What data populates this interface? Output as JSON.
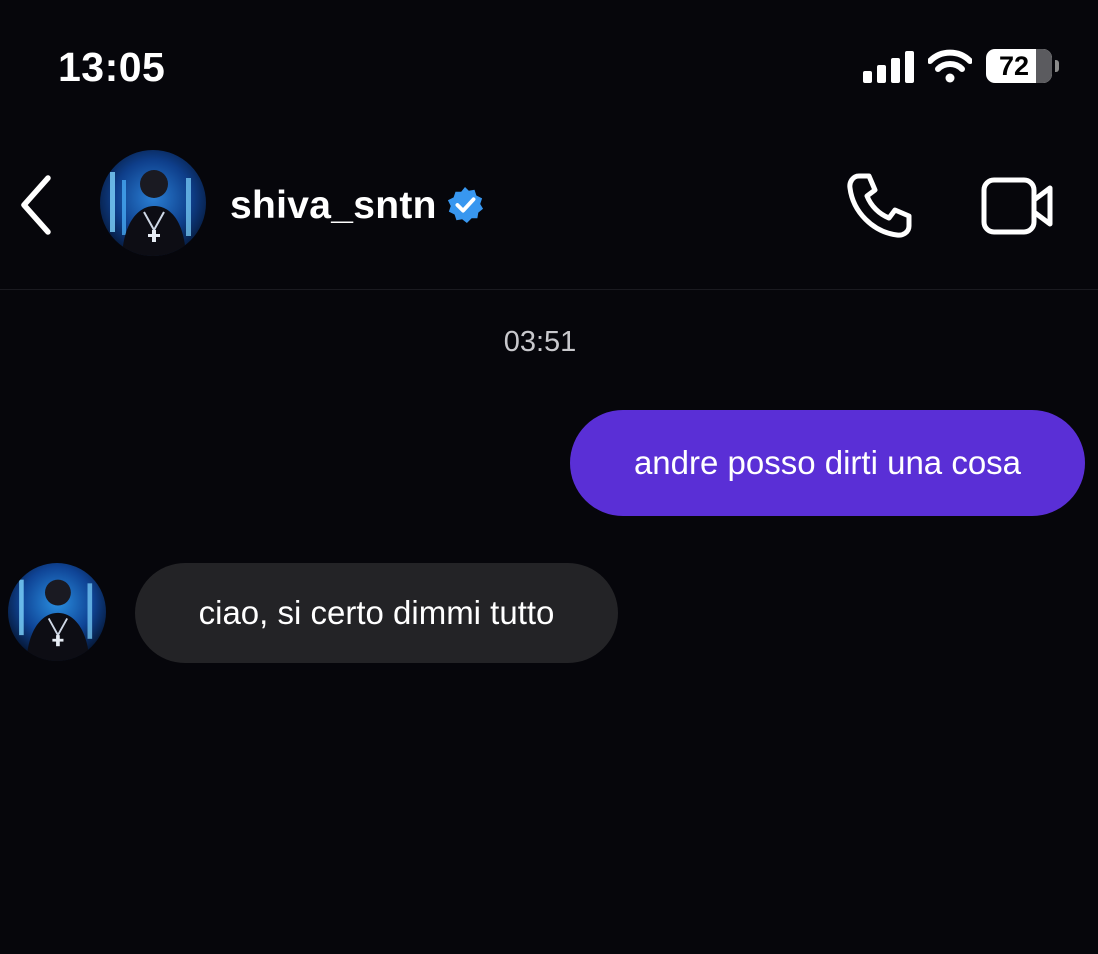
{
  "status_bar": {
    "time": "13:05",
    "battery_level": "72",
    "icons": [
      "signal-icon",
      "wifi-icon",
      "battery-icon"
    ]
  },
  "header": {
    "username": "shiva_sntn",
    "verified": true,
    "icons": [
      "back-arrow-icon",
      "avatar",
      "verified-badge-icon",
      "phone-call-icon",
      "video-call-icon"
    ]
  },
  "conversation": {
    "timestamp": "03:51",
    "messages": [
      {
        "direction": "outgoing",
        "text": "andre posso dirti una cosa"
      },
      {
        "direction": "incoming",
        "text": "ciao, si certo dimmi tutto"
      }
    ]
  },
  "colors": {
    "background": "#06060b",
    "outgoing_bubble": "#5a2fd6",
    "incoming_bubble": "#232326",
    "verified_badge": "#3897f0",
    "text": "#ffffff"
  }
}
